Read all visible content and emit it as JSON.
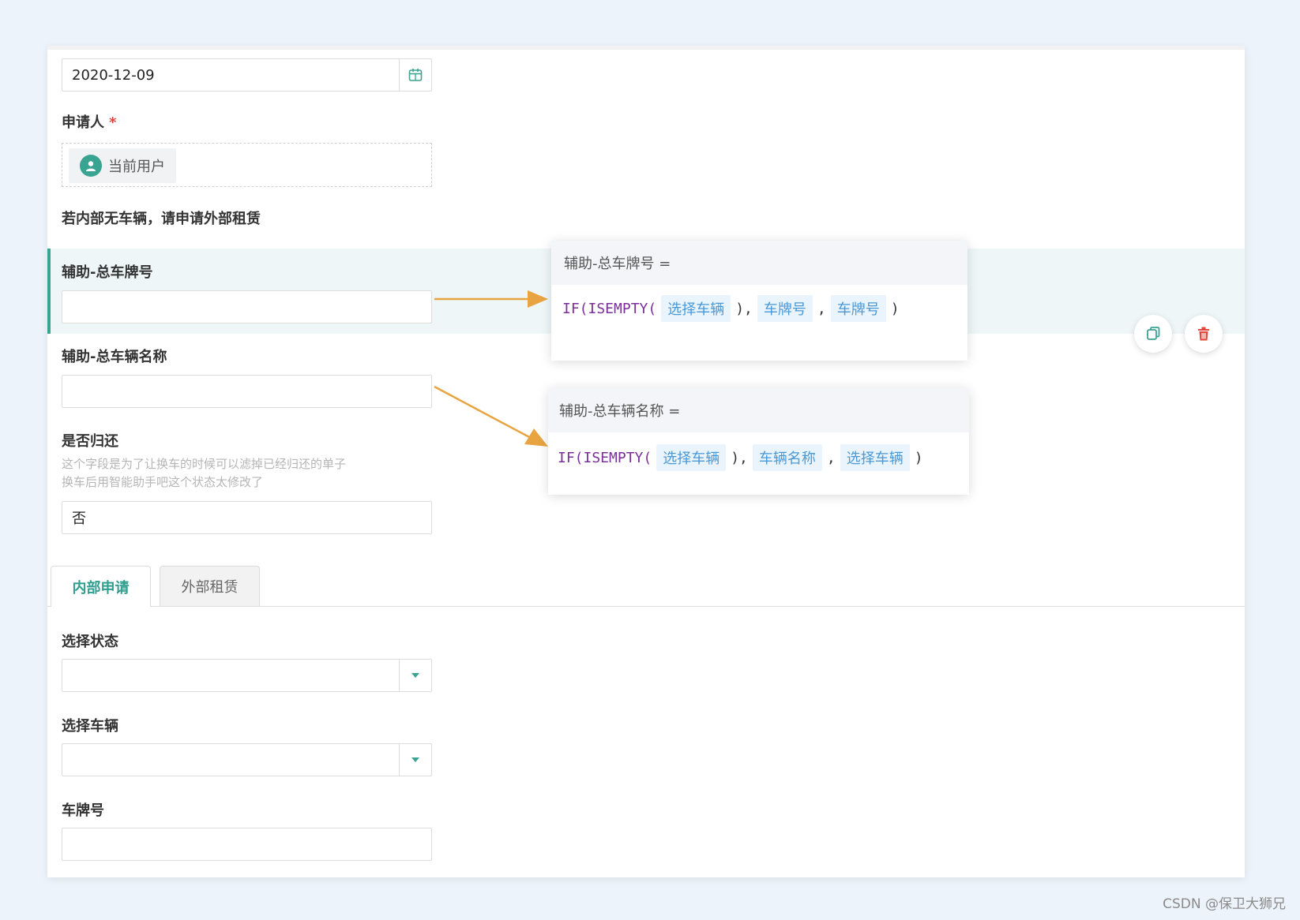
{
  "form": {
    "date_value": "2020-12-09",
    "applicant_label": "申请人",
    "required_mark": "*",
    "applicant_chip": "当前用户",
    "notice": "若内部无车辆，请申请外部租赁",
    "plate_total_label": "辅助-总车牌号",
    "vehicle_total_label": "辅助-总车辆名称",
    "return_label": "是否归还",
    "return_hint_1": "这个字段是为了让换车的时候可以滤掉已经归还的单子",
    "return_hint_2": "换车后用智能助手吧这个状态太修改了",
    "return_value": "否",
    "status_label": "选择状态",
    "vehicle_label": "选择车辆",
    "plate_label": "车牌号"
  },
  "tabs": [
    {
      "label": "内部申请",
      "active": true
    },
    {
      "label": "外部租赁",
      "active": false
    }
  ],
  "popups": {
    "plate": {
      "header": "辅助-总车牌号 =",
      "fn": "IF(ISEMPTY(",
      "tok1": "选择车辆",
      "sep1": "),",
      "tok2": "车牌号",
      "sep2": ",",
      "tok3": "车牌号",
      "close": ")"
    },
    "vehicle": {
      "header": "辅助-总车辆名称 =",
      "fn": "IF(ISEMPTY(",
      "tok1": "选择车辆",
      "sep1": "),",
      "tok2": "车辆名称",
      "sep2": ",",
      "tok3": "选择车辆",
      "close": ")"
    }
  },
  "watermark": "CSDN @保卫大狮兄",
  "colors": {
    "accent": "#3aa493",
    "arrow": "#e8a440",
    "token_bg": "#e9f4fc",
    "token_text": "#4a98d6",
    "function_text": "#7b2f9a",
    "delete_red": "#e0463a"
  }
}
